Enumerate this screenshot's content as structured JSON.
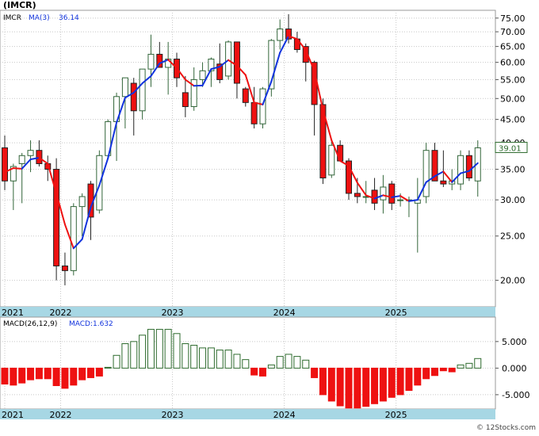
{
  "title": "(IMCR)",
  "legend": {
    "ticker": "IMCR",
    "ma_label": "MA(3)",
    "ma_value": "36.14"
  },
  "last_price": "39.01",
  "macd_legend": {
    "label": "MACD(26,12,9)",
    "value_label": "MACD:1.632"
  },
  "watermark": "© 12Stocks.com",
  "colors": {
    "up": "#33663a",
    "down": "#ee1111",
    "ma_up": "#1133dd",
    "ma_down": "#ee1111",
    "axis_band": "#a7d7e4",
    "grid": "#c8c8c8",
    "macd_pos": "#2e6b2e",
    "macd_neg": "#ee1111"
  },
  "chart_data": [
    {
      "type": "candlestick",
      "name": "IMCR",
      "x_labels": [
        "2021",
        "2022",
        "2023",
        "2024",
        "2025"
      ],
      "y_scale": "log",
      "ylim": [
        17.5,
        78
      ],
      "y_ticks": [
        "75.00",
        "70.00",
        "65.00",
        "60.00",
        "55.00",
        "50.00",
        "45.00",
        "40.00",
        "35.00",
        "30.00",
        "25.00",
        "20.00"
      ],
      "candles": [
        [
          39.0,
          41.5,
          31.5,
          33.0
        ],
        [
          33.0,
          36.0,
          28.5,
          35.5
        ],
        [
          36.0,
          38.0,
          29.5,
          37.5
        ],
        [
          37.5,
          40.5,
          34.5,
          38.5
        ],
        [
          38.5,
          40.5,
          35.5,
          36.0
        ],
        [
          36.0,
          37.5,
          33.0,
          35.0
        ],
        [
          35.0,
          37.0,
          20.0,
          21.5
        ],
        [
          21.5,
          23.0,
          19.5,
          21.0
        ],
        [
          21.0,
          29.5,
          20.5,
          29.0
        ],
        [
          29.0,
          31.0,
          25.0,
          30.5
        ],
        [
          32.5,
          33.0,
          24.5,
          27.5
        ],
        [
          28.5,
          38.5,
          28.0,
          37.5
        ],
        [
          37.5,
          45.0,
          37.0,
          44.5
        ],
        [
          44.5,
          51.5,
          36.5,
          50.5
        ],
        [
          50.5,
          55.5,
          43.0,
          55.5
        ],
        [
          54.0,
          55.5,
          41.5,
          47.0
        ],
        [
          47.0,
          58.0,
          45.0,
          58.0
        ],
        [
          58.0,
          69.0,
          53.0,
          62.5
        ],
        [
          62.5,
          66.5,
          59.0,
          58.5
        ],
        [
          58.5,
          66.5,
          51.0,
          61.0
        ],
        [
          61.0,
          63.0,
          53.0,
          55.5
        ],
        [
          51.5,
          56.0,
          45.5,
          48.0
        ],
        [
          48.0,
          58.5,
          47.0,
          55.0
        ],
        [
          55.0,
          60.0,
          53.0,
          57.5
        ],
        [
          57.5,
          61.5,
          53.0,
          61.0
        ],
        [
          59.5,
          66.0,
          54.0,
          55.0
        ],
        [
          56.0,
          67.0,
          55.0,
          66.5
        ],
        [
          66.5,
          66.5,
          50.0,
          54.0
        ],
        [
          52.5,
          53.0,
          48.0,
          49.0
        ],
        [
          49.0,
          53.0,
          43.0,
          44.0
        ],
        [
          44.0,
          53.0,
          43.0,
          52.5
        ],
        [
          52.5,
          67.5,
          50.5,
          67.0
        ],
        [
          67.0,
          74.5,
          64.0,
          71.0
        ],
        [
          71.0,
          76.5,
          66.0,
          67.5
        ],
        [
          67.5,
          70.0,
          63.0,
          64.0
        ],
        [
          65.0,
          66.0,
          54.5,
          60.0
        ],
        [
          60.0,
          60.5,
          41.5,
          48.5
        ],
        [
          48.5,
          50.0,
          32.5,
          33.5
        ],
        [
          34.0,
          40.5,
          33.5,
          39.5
        ],
        [
          39.5,
          40.5,
          36.5,
          36.5
        ],
        [
          36.5,
          37.0,
          30.0,
          31.0
        ],
        [
          31.0,
          33.5,
          29.5,
          30.5
        ],
        [
          30.5,
          33.0,
          29.5,
          30.5
        ],
        [
          31.5,
          33.5,
          28.5,
          29.5
        ],
        [
          30.0,
          34.0,
          28.0,
          32.0
        ],
        [
          32.5,
          33.0,
          28.5,
          29.5
        ],
        [
          30.0,
          31.0,
          29.0,
          30.0
        ],
        [
          30.0,
          30.5,
          27.5,
          30.0
        ],
        [
          29.5,
          33.5,
          23.0,
          30.0
        ],
        [
          30.5,
          40.0,
          29.5,
          38.5
        ],
        [
          38.5,
          40.0,
          33.0,
          33.0
        ],
        [
          33.0,
          38.5,
          32.0,
          32.5
        ],
        [
          32.5,
          35.0,
          31.5,
          33.0
        ],
        [
          32.5,
          38.5,
          31.5,
          37.5
        ],
        [
          37.5,
          38.5,
          33.0,
          33.5
        ],
        [
          33.0,
          40.5,
          30.5,
          39.0
        ]
      ],
      "ma_label": "MA(3)",
      "ma": [
        [
          34.5,
          "down"
        ],
        [
          35.2,
          "down"
        ],
        [
          35.1,
          "down"
        ],
        [
          36.8,
          "up"
        ],
        [
          37.1,
          "up"
        ],
        [
          36.0,
          "down"
        ],
        [
          31.0,
          "down"
        ],
        [
          26.5,
          "down"
        ],
        [
          23.5,
          "down"
        ],
        [
          24.6,
          "up"
        ],
        [
          28.9,
          "up"
        ],
        [
          32.3,
          "up"
        ],
        [
          37.0,
          "up"
        ],
        [
          44.3,
          "up"
        ],
        [
          50.2,
          "up"
        ],
        [
          51.5,
          "up"
        ],
        [
          54.0,
          "up"
        ],
        [
          56.0,
          "up"
        ],
        [
          59.7,
          "up"
        ],
        [
          60.8,
          "up"
        ],
        [
          58.3,
          "down"
        ],
        [
          55.0,
          "down"
        ],
        [
          53.3,
          "down"
        ],
        [
          53.4,
          "up"
        ],
        [
          58.0,
          "up"
        ],
        [
          58.7,
          "up"
        ],
        [
          60.7,
          "up"
        ],
        [
          59.0,
          "down"
        ],
        [
          56.3,
          "down"
        ],
        [
          49.0,
          "down"
        ],
        [
          48.5,
          "down"
        ],
        [
          54.5,
          "up"
        ],
        [
          63.0,
          "up"
        ],
        [
          68.5,
          "up"
        ],
        [
          67.5,
          "down"
        ],
        [
          63.8,
          "down"
        ],
        [
          57.5,
          "down"
        ],
        [
          47.3,
          "down"
        ],
        [
          40.5,
          "down"
        ],
        [
          36.5,
          "down"
        ],
        [
          35.6,
          "down"
        ],
        [
          32.7,
          "down"
        ],
        [
          30.7,
          "down"
        ],
        [
          30.2,
          "down"
        ],
        [
          30.7,
          "up"
        ],
        [
          30.4,
          "down"
        ],
        [
          30.6,
          "up"
        ],
        [
          29.8,
          "down"
        ],
        [
          30.0,
          "up"
        ],
        [
          32.8,
          "up"
        ],
        [
          33.8,
          "up"
        ],
        [
          34.6,
          "up"
        ],
        [
          32.8,
          "down"
        ],
        [
          34.3,
          "up"
        ],
        [
          34.7,
          "up"
        ],
        [
          36.1,
          "up"
        ]
      ]
    },
    {
      "type": "bar",
      "name": "MACD(26,12,9)",
      "ylim": [
        -7.7,
        9.6
      ],
      "y_ticks": [
        "5.000",
        "0.000",
        "-5.000"
      ],
      "x_labels": [
        "2021",
        "2022",
        "2023",
        "2024",
        "2025"
      ],
      "values": [
        -3.0,
        -3.2,
        -2.8,
        -2.2,
        -2.0,
        -2.0,
        -3.3,
        -3.8,
        -3.2,
        -2.2,
        -1.8,
        -1.5,
        0.0,
        2.4,
        4.6,
        5.0,
        6.2,
        7.3,
        7.3,
        7.3,
        6.5,
        4.6,
        4.3,
        3.8,
        3.8,
        3.4,
        3.4,
        2.6,
        1.6,
        -1.3,
        -1.5,
        0.6,
        2.2,
        2.6,
        2.2,
        1.5,
        -1.8,
        -5.0,
        -6.2,
        -7.1,
        -7.5,
        -7.5,
        -7.2,
        -6.7,
        -6.2,
        -5.5,
        -5.0,
        -4.2,
        -3.2,
        -2.0,
        -1.4,
        -0.5,
        -0.7,
        0.6,
        0.9,
        1.8
      ]
    }
  ]
}
